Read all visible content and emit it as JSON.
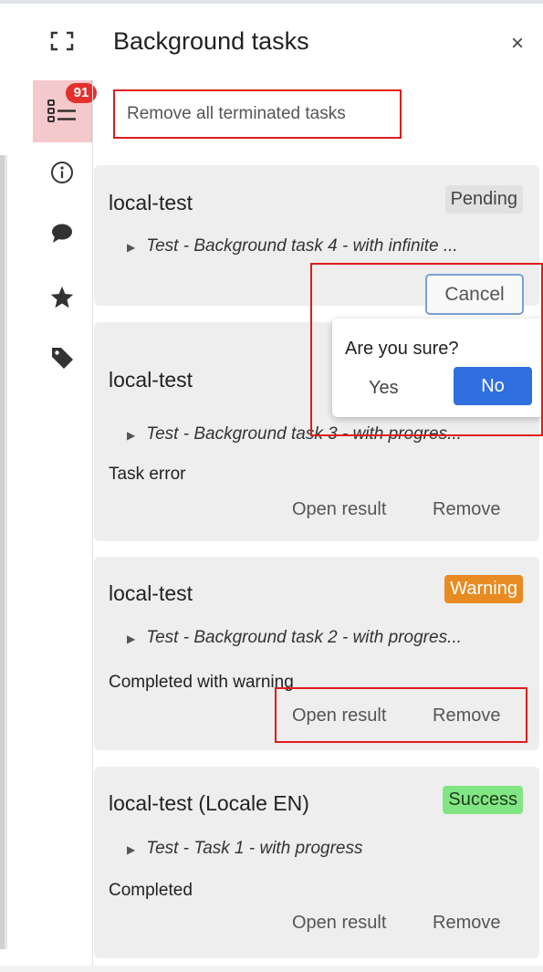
{
  "panel": {
    "title": "Background tasks",
    "close_label": "×",
    "remove_all_label": "Remove all terminated tasks"
  },
  "rail": {
    "badge_count": "91",
    "icons": [
      "expand-icon",
      "task-list-icon",
      "info-icon",
      "comment-icon",
      "star-icon",
      "tag-icon"
    ]
  },
  "tasks": [
    {
      "title": "local-test",
      "status": "Pending",
      "task_name": "Test - Background task 4 - with infinite ...",
      "action_cancel": "Cancel"
    },
    {
      "title": "local-test",
      "status": "",
      "task_name": "Test - Background task 3 - with progres...",
      "message": "Task error",
      "action_open": "Open result",
      "action_remove": "Remove"
    },
    {
      "title": "local-test",
      "status": "Warning",
      "task_name": "Test - Background task 2 - with progres...",
      "message": "Completed with warning",
      "action_open": "Open result",
      "action_remove": "Remove"
    },
    {
      "title": "local-test (Locale EN)",
      "status": "Success",
      "task_name": "Test - Task 1 - with progress",
      "message": "Completed",
      "action_open": "Open result",
      "action_remove": "Remove"
    }
  ],
  "confirm": {
    "question": "Are you sure?",
    "yes_label": "Yes",
    "no_label": "No"
  },
  "colors": {
    "highlight_red": "#e21b1b",
    "primary_blue": "#2f6fe0",
    "warning_orange": "#e88b22",
    "success_green": "#82e583"
  }
}
